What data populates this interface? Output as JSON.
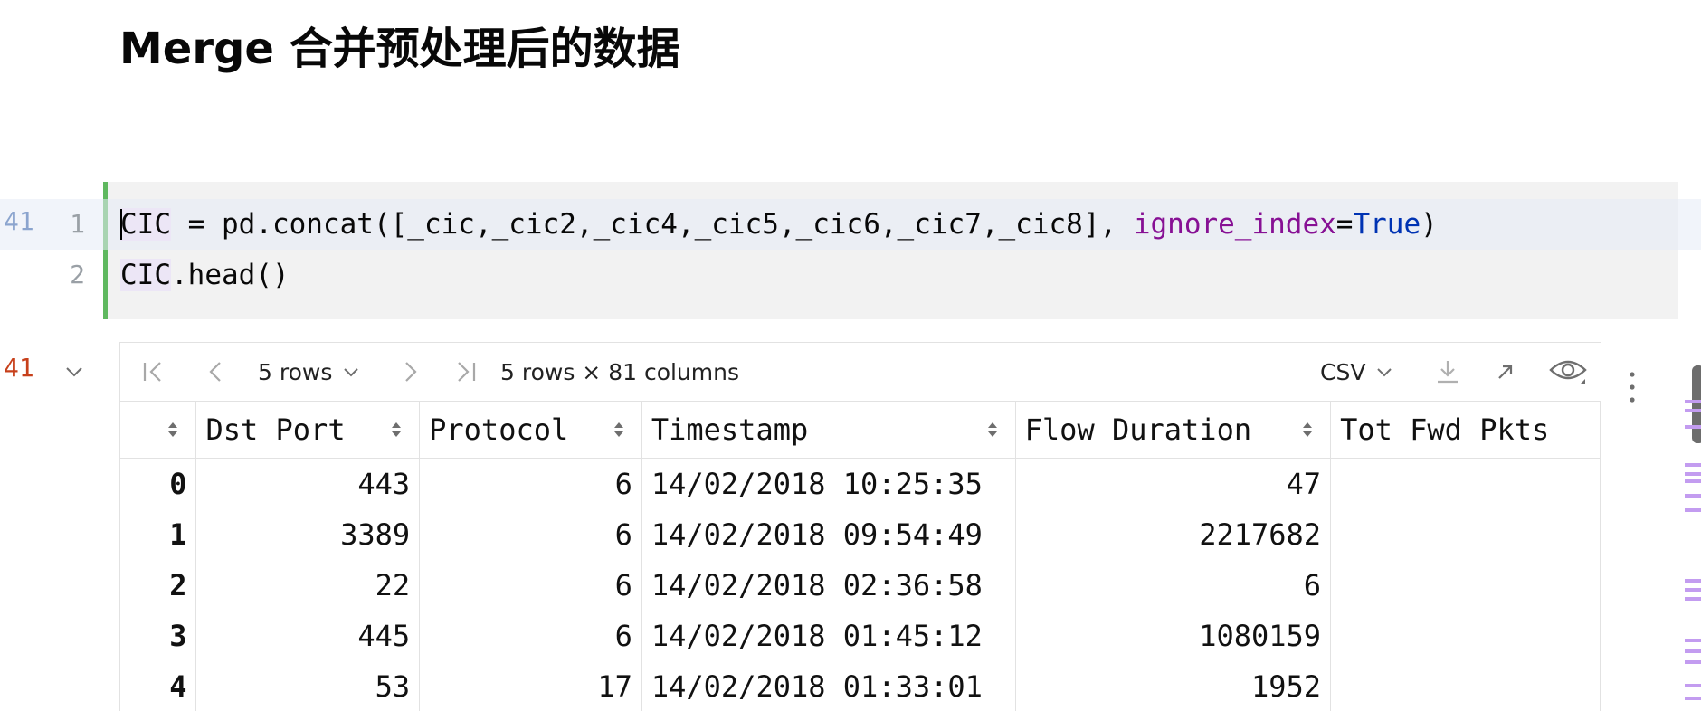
{
  "markdown": {
    "heading": "Merge 合并预处理后的数据"
  },
  "code_cell": {
    "exec_count": "41",
    "lines": [
      {
        "number": "1",
        "var": "CIC",
        "middle": " = pd.concat([_cic,_cic2,_cic4,_cic5,_cic6,_cic7,_cic8], ",
        "kwarg": "ignore_index",
        "eq": "=",
        "const": "True",
        "end": ")"
      },
      {
        "number": "2",
        "var": "CIC",
        "rest": ".head()"
      }
    ]
  },
  "output": {
    "exec_count": "41",
    "toolbar": {
      "rows_select": "5 rows",
      "summary": "5 rows × 81 columns",
      "export_format": "CSV"
    },
    "table": {
      "columns": [
        "Dst Port",
        "Protocol",
        "Timestamp",
        "Flow Duration",
        "Tot Fwd Pkts"
      ],
      "rows": [
        {
          "index": "0",
          "cells": [
            "443",
            "6",
            "14/02/2018 10:25:35",
            "47",
            ""
          ]
        },
        {
          "index": "1",
          "cells": [
            "3389",
            "6",
            "14/02/2018 09:54:49",
            "2217682",
            ""
          ]
        },
        {
          "index": "2",
          "cells": [
            "22",
            "6",
            "14/02/2018 02:36:58",
            "6",
            ""
          ]
        },
        {
          "index": "3",
          "cells": [
            "445",
            "6",
            "14/02/2018 01:45:12",
            "1080159",
            ""
          ]
        },
        {
          "index": "4",
          "cells": [
            "53",
            "17",
            "14/02/2018 01:33:01",
            "1952",
            ""
          ]
        }
      ]
    }
  },
  "colors": {
    "cell_border_active": "#5fb85f",
    "exec_count_input": "#1d4f9e",
    "exec_count_output": "#c7401b",
    "keyword_arg": "#871094",
    "constant": "#0033b3"
  }
}
